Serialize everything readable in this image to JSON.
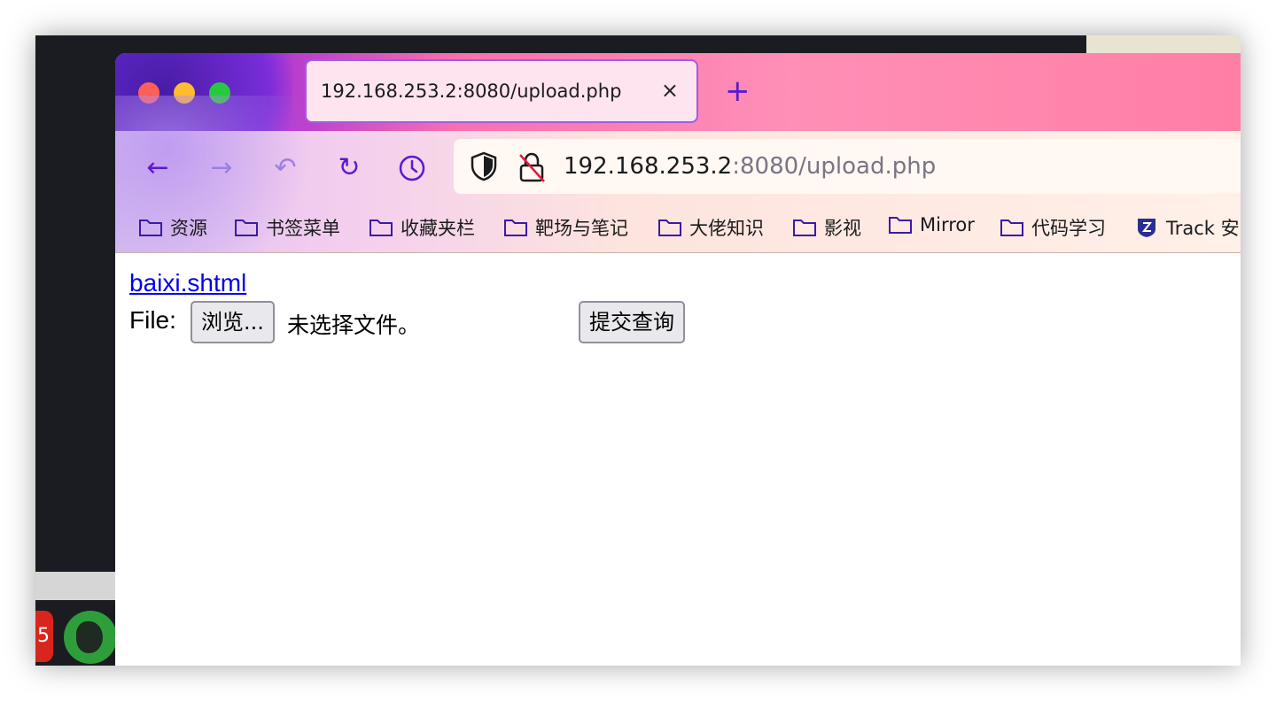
{
  "tab": {
    "title": "192.168.253.2:8080/upload.php",
    "close": "×",
    "new_tab": "+"
  },
  "nav": {
    "back": "←",
    "forward": "→",
    "undo": "↶",
    "reload": "↻"
  },
  "urlbar": {
    "host": "192.168.253.2",
    "rest": ":8080/upload.php"
  },
  "bookmarks": [
    {
      "label": "资源",
      "icon": "folder-icon"
    },
    {
      "label": "书签菜单",
      "icon": "folder-icon"
    },
    {
      "label": "收藏夹栏",
      "icon": "folder-icon"
    },
    {
      "label": "靶场与笔记",
      "icon": "folder-icon"
    },
    {
      "label": "大佬知识",
      "icon": "folder-icon"
    },
    {
      "label": "影视",
      "icon": "folder-icon"
    },
    {
      "label": "Mirror",
      "icon": "folder-icon"
    },
    {
      "label": "代码学习",
      "icon": "folder-icon"
    },
    {
      "label": "Track 安",
      "icon": "track-icon"
    }
  ],
  "page": {
    "link": "baixi.shtml",
    "file_label": "File:",
    "browse_button": "浏览...",
    "no_file_text": "未选择文件。",
    "submit_button": "提交查询"
  },
  "colors": {
    "accent": "#5b1ad0",
    "link": "#0000ee"
  }
}
